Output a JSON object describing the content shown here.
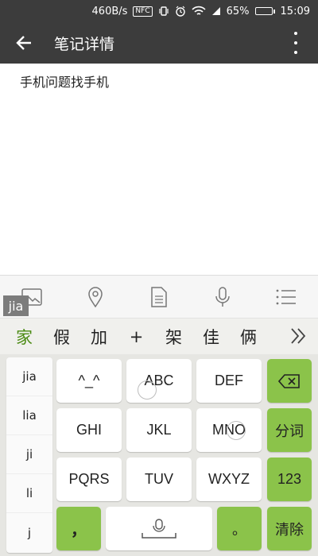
{
  "status_bar": {
    "speed": "460B/s",
    "nfc": "NFC",
    "battery": "65%",
    "battery_level": 0.65,
    "time": "15:09"
  },
  "app_bar": {
    "title": "笔记详情"
  },
  "note": {
    "content": "手机问题找手机"
  },
  "toolbar": {
    "icons": [
      "image-icon",
      "location-icon",
      "document-icon",
      "microphone-icon",
      "list-icon"
    ]
  },
  "ime": {
    "pinyin_input": "jia",
    "candidates": [
      "家",
      "假",
      "加",
      "+",
      "架",
      "佳",
      "俩"
    ],
    "pinyin_options": [
      "jia",
      "lia",
      "ji",
      "li",
      "j"
    ],
    "keys": {
      "row1": [
        "^_^",
        "ABC",
        "DEF"
      ],
      "row2": [
        "GHI",
        "JKL",
        "MNO"
      ],
      "row3": [
        "PQRS",
        "TUV",
        "WXYZ"
      ],
      "comma": "，",
      "period": "。",
      "segment": "分词",
      "numbers": "123",
      "clear": "清除"
    },
    "accent_color": "#8bc34a"
  }
}
